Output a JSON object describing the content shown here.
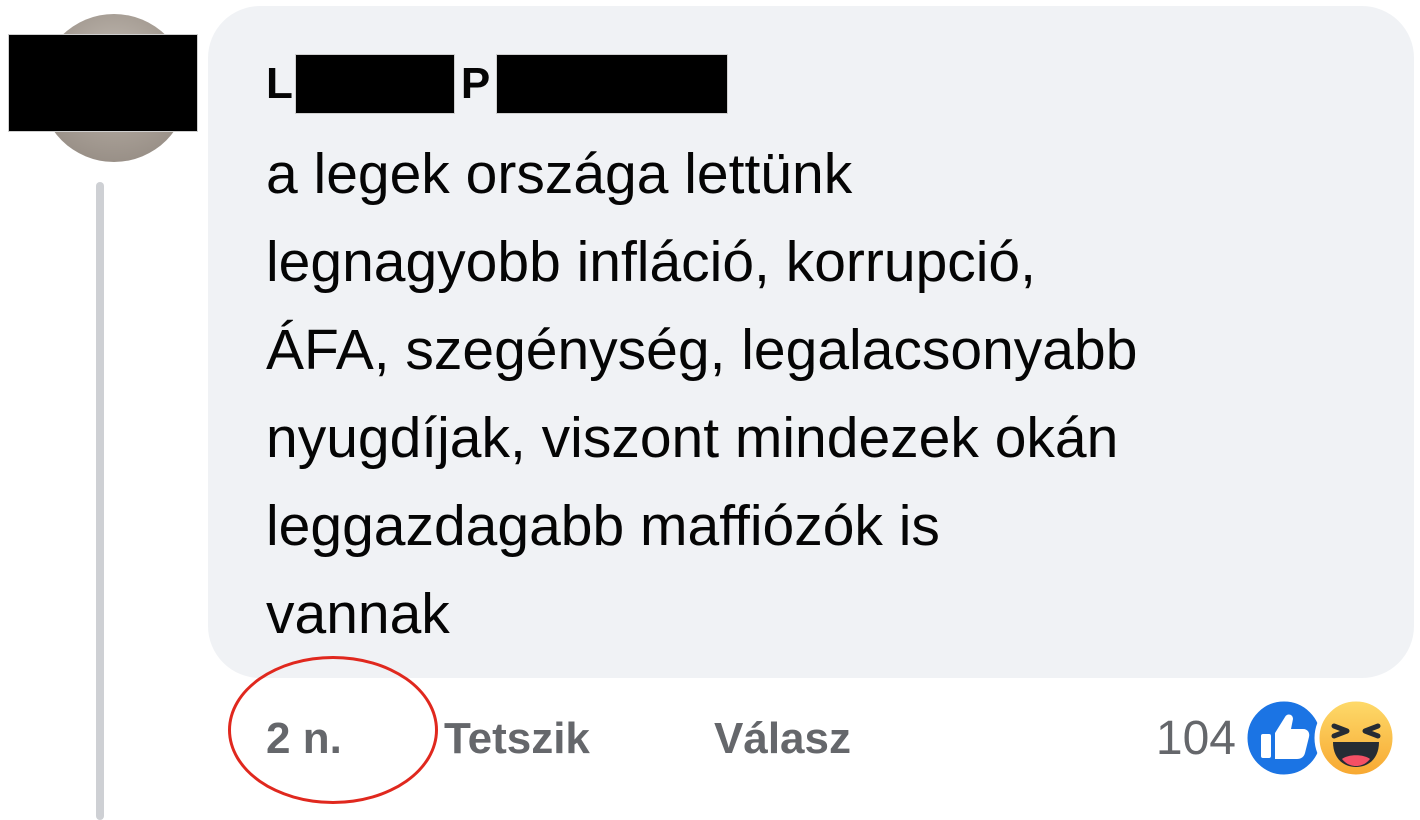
{
  "comment": {
    "author": {
      "first_initial": "L",
      "last_initial": "P"
    },
    "text": "a legek országa lettünk\nlegnagyobb infláció, korrupció,\nÁFA, szegénység, legalacsonyabb\nnyugdíjak, viszont mindezek okán\nleggazdagabb maffiózók is\nvannak"
  },
  "actions": {
    "time": "2 n.",
    "like": "Tetszik",
    "reply": "Válasz"
  },
  "reactions": {
    "count": "104",
    "icons": [
      "like-icon",
      "haha-icon"
    ]
  },
  "colors": {
    "bubble": "#f0f2f5",
    "text": "#050505",
    "secondary_text": "#65676b",
    "like_blue": "#1b74e4",
    "highlight_red": "#e0281e"
  }
}
